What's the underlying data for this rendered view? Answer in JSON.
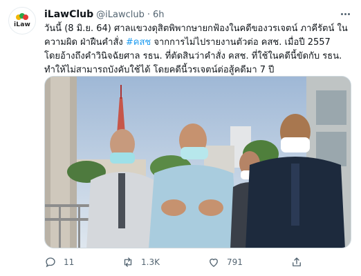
{
  "tweet": {
    "avatar": {
      "label": "iLaw",
      "icon": "ilaw-logo-icon"
    },
    "display_name": "iLawClub",
    "handle": "@iLawclub",
    "separator": "·",
    "time": "6h",
    "more_icon": "more-options-icon",
    "text_parts": {
      "before_hashtag": "วันนี้ (8 มิ.ย. 64) ศาลแขวงดุสิตพิพากษายกฟ้องในคดีของวรเจตน์ ภาคีรัตน์ ในความผิด ฝ่าฝืนคำสั่ง ",
      "hashtag": "#คสช",
      "after_hashtag": " จากการไม่ไปรายงานตัวต่อ คสช. เมื่อปี 2557 โดยอ้างถึงคำวินิจฉัยศาล รธน. ที่ตัดสินว่าคำสั่ง คสช. ที่ใช้ในคดีนี้ขัดกับ รธน. ทำให้ไม่สามารถบังคับใช้ได้ โดยคดีนี้วรเจตน์ต่อสู้คดีมา 7 ปี"
    },
    "media": {
      "description_icon": "photo"
    },
    "actions": {
      "reply": {
        "icon": "reply-icon",
        "count": "11"
      },
      "retweet": {
        "icon": "retweet-icon",
        "count": "1.3K"
      },
      "like": {
        "icon": "heart-icon",
        "count": "791"
      },
      "share": {
        "icon": "share-icon"
      }
    },
    "colors": {
      "link": "#1d9bf0",
      "muted": "#536471",
      "text": "#0f1419"
    }
  }
}
